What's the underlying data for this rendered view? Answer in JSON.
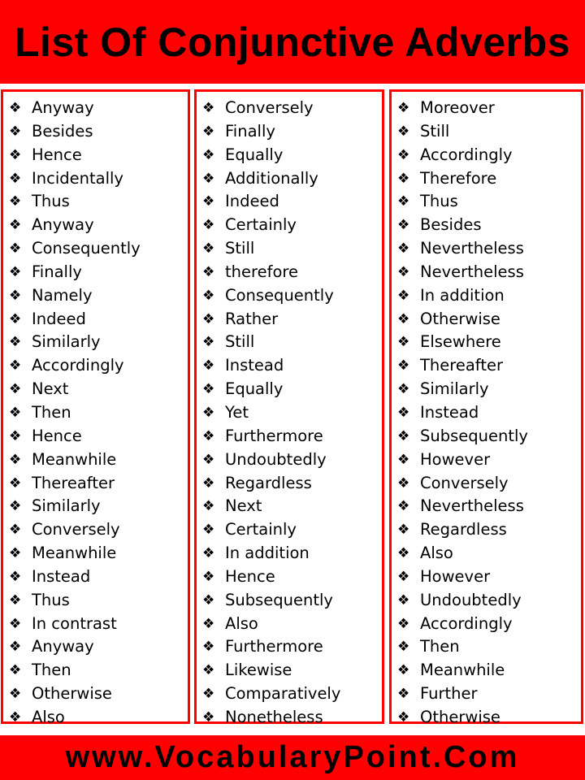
{
  "title": "List Of Conjunctive Adverbs",
  "bullet_icon": "diamond-four-bullet",
  "colors": {
    "accent": "#ff0000",
    "text": "#000000"
  },
  "columns": [
    [
      "Anyway",
      "Besides",
      "Hence",
      "Incidentally",
      "Thus",
      "Anyway",
      "Consequently",
      "Finally",
      "Namely",
      "Indeed",
      "Similarly",
      "Accordingly",
      "Next",
      "Then",
      "Hence",
      "Meanwhile",
      "Thereafter",
      "Similarly",
      "Conversely",
      "Meanwhile",
      "Instead",
      "Thus",
      "In contrast",
      "Anyway",
      "Then",
      "Otherwise",
      "Also"
    ],
    [
      "Conversely",
      "Finally",
      "Equally",
      "Additionally",
      "Indeed",
      "Certainly",
      "Still",
      "therefore",
      "Consequently",
      "Rather",
      "Still",
      "Instead",
      "Equally",
      "Yet",
      "Furthermore",
      "Undoubtedly",
      "Regardless",
      "Next",
      "Certainly",
      "In addition",
      "Hence",
      "Subsequently",
      "Also",
      "Furthermore",
      "Likewise",
      "Comparatively",
      "Nonetheless"
    ],
    [
      "Moreover",
      "Still",
      "Accordingly",
      "Therefore",
      "Thus",
      "Besides",
      "Nevertheless",
      "Nevertheless",
      "In addition",
      "Otherwise",
      "Elsewhere",
      "Thereafter",
      "Similarly",
      "Instead",
      "Subsequently",
      "However",
      "Conversely",
      "Nevertheless",
      "Regardless",
      "Also",
      "However",
      "Undoubtedly",
      "Accordingly",
      "Then",
      "Meanwhile",
      "Further",
      "Otherwise"
    ]
  ],
  "footer": "www.VocabularyPoint.Com"
}
